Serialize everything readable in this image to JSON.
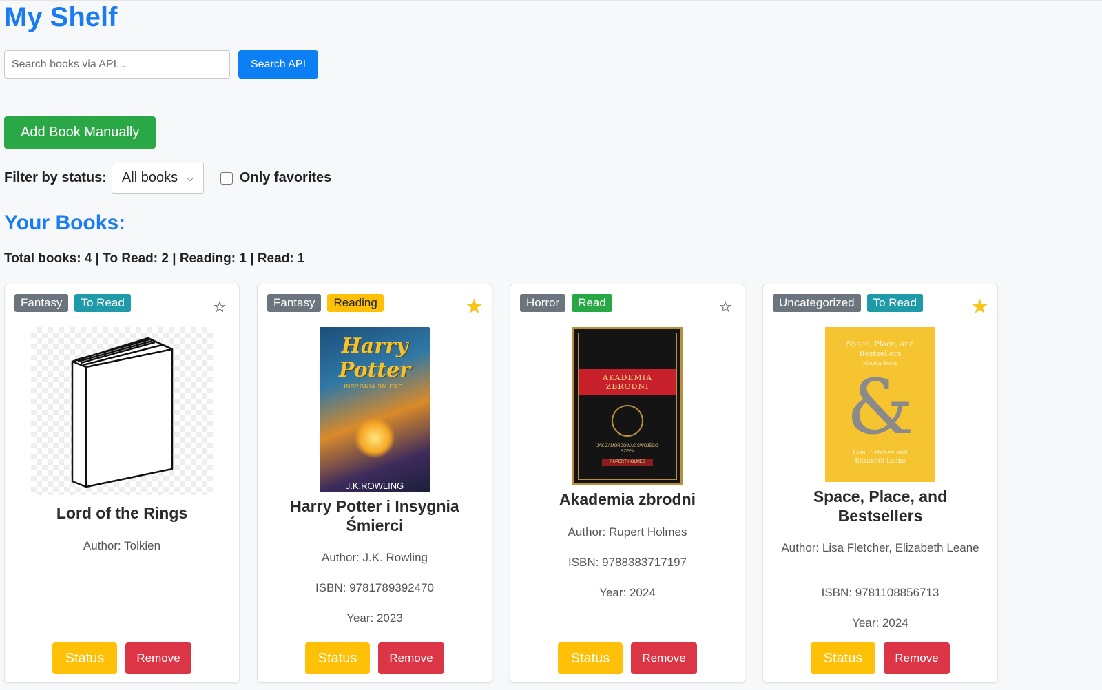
{
  "header": {
    "title": "My Shelf"
  },
  "search": {
    "placeholder": "Search books via API...",
    "value": "",
    "button_label": "Search API"
  },
  "add_button_label": "Add Book Manually",
  "filter": {
    "label": "Filter by status:",
    "selected": "All books",
    "favorites_label": "Only favorites",
    "favorites_checked": false
  },
  "section_title": "Your Books:",
  "stats_text": "Total books: 4 | To Read: 2 | Reading: 1 | Read: 1",
  "books": [
    {
      "genre": "Fantasy",
      "status": "To Read",
      "favorite": false,
      "title": "Lord of the Rings",
      "author": "Author: Tolkien",
      "cover": "book-placeholder-icon"
    },
    {
      "genre": "Fantasy",
      "status": "Reading",
      "favorite": true,
      "title": "Harry Potter i Insygnia Śmierci",
      "author": "Author: J.K. Rowling",
      "isbn": "ISBN: 9781789392470",
      "year": "Year: 2023",
      "cover_title": "Harry Potter",
      "cover_subtitle": "INSYGNIA ŚMIERCI",
      "cover_author": "J.K.ROWLING"
    },
    {
      "genre": "Horror",
      "status": "Read",
      "favorite": false,
      "title": "Akademia zbrodni",
      "author": "Author: Rupert Holmes",
      "isbn": "ISBN: 9788383717197",
      "year": "Year: 2024",
      "cover_title": "AKADEMIA ZBRODNI",
      "cover_subtitle": "JAK ZAMORDOWAĆ SWOJEGO SZEFA",
      "cover_author": "RUPERT HOLMES"
    },
    {
      "genre": "Uncategorized",
      "status": "To Read",
      "favorite": true,
      "title": "Space, Place, and Bestsellers",
      "author": "Author: Lisa Fletcher, Elizabeth Leane",
      "isbn": "ISBN: 9781108856713",
      "year": "Year: 2024",
      "cover_title": "Space, Place, and Bestsellers",
      "cover_subtitle": "Moving Books",
      "cover_author": "Lisa Fletcher and Elizabeth Leane"
    }
  ],
  "card_actions": {
    "status_label": "Status",
    "remove_label": "Remove"
  },
  "colors": {
    "accent": "#1a7cf2",
    "search_button": "#0d7ff5",
    "add_button": "#2aa845",
    "status_button": "#ffc107",
    "remove_button": "#dc3545",
    "badge_genre": "#6c757d",
    "badge_to_read": "#1e9aa8",
    "badge_reading": "#ffc107",
    "badge_read": "#28a745",
    "star": "#f5c518"
  }
}
